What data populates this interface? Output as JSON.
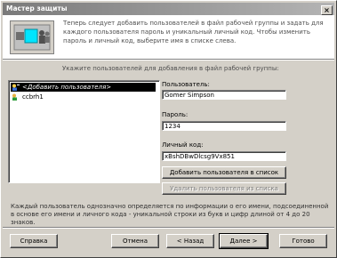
{
  "window": {
    "title": "Мастер защиты",
    "close_glyph": "×"
  },
  "header": {
    "description": "Теперь следует добавить пользователей в файл рабочей группы и задать для каждого пользователя пароль и уникальный личный код. Чтобы изменить пароль и личный код, выберите имя в списке слева."
  },
  "instruction": "Укажите пользователей для добавления в файл рабочей группы:",
  "user_list": {
    "items": [
      {
        "label": "<Добавить пользователя>",
        "selected": true,
        "icon": "user-add-icon"
      },
      {
        "label": "ccbrh1",
        "selected": false,
        "icon": "user-icon"
      }
    ]
  },
  "form": {
    "user_label": "Пользователь:",
    "user_value": "Gomer Simpson",
    "password_label": "Пароль:",
    "password_value": "1234",
    "pid_label": "Личный код:",
    "pid_value": "xBshDBwDlcsg9Vx851",
    "add_button": "Добавить пользователя в список",
    "remove_button": "Удалить пользователя из списка"
  },
  "footer_text": "Каждый пользователь однозначно определяется по информации о его имени, подсоединенной в основе его имени и личного кода - уникальной строки из букв и цифр длиной от 4 до 20 знаков.",
  "buttons": {
    "help": "Справка",
    "cancel": "Отмена",
    "back": "< Назад",
    "next": "Далее >",
    "finish": "Готово"
  }
}
